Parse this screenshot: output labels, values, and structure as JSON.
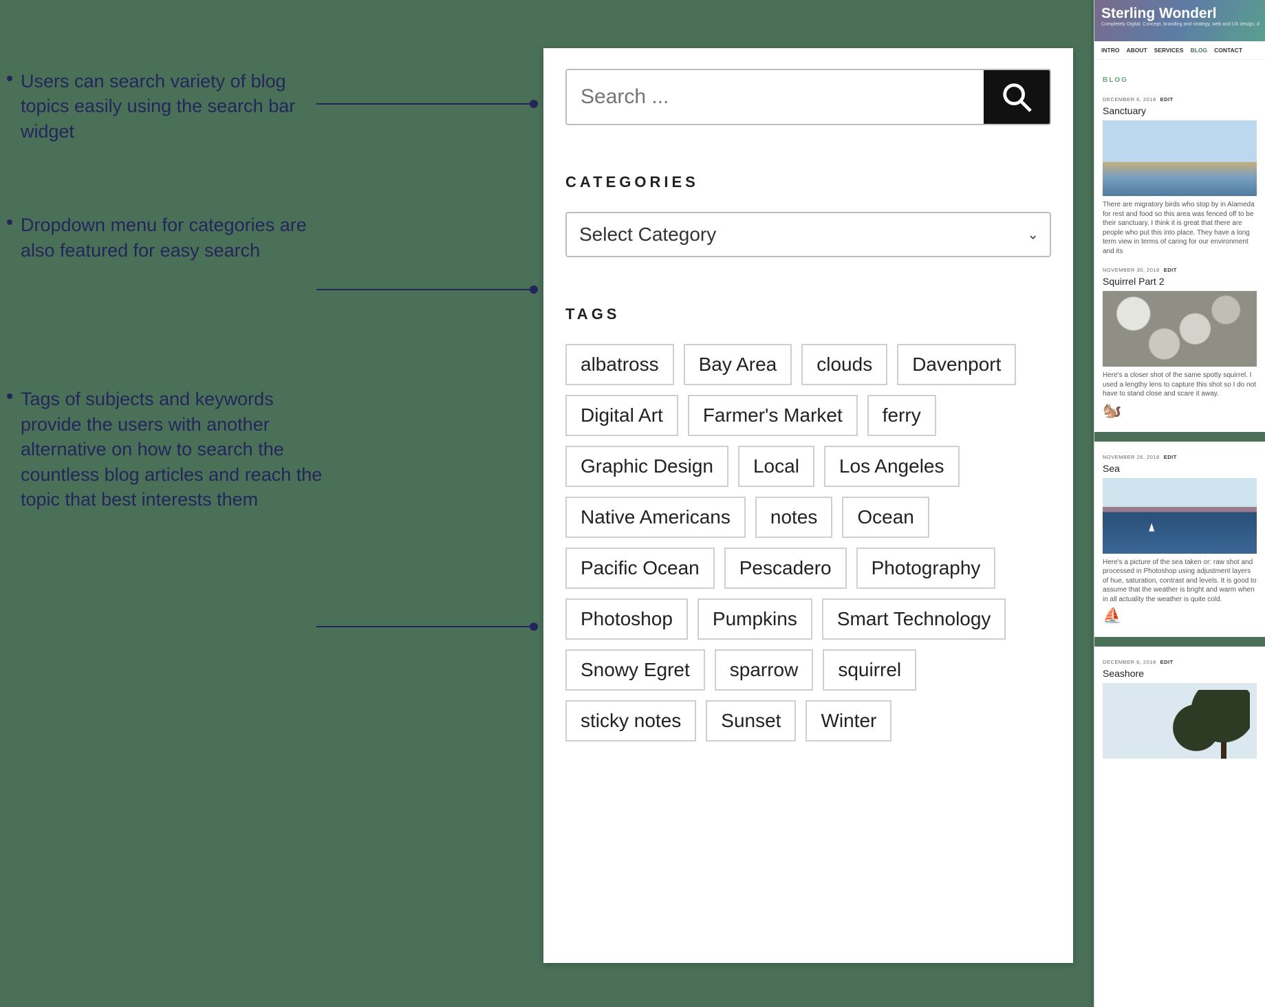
{
  "annotations": {
    "a1": "Users can search variety of blog topics easily using the search bar widget",
    "a2": "Dropdown menu for categories are also featured for easy search",
    "a3": "Tags of subjects and keywords provide the users with another alternative on how to search the countless blog articles and reach the topic that best interests them"
  },
  "sidebar": {
    "search_placeholder": "Search ...",
    "categories_heading": "CATEGORIES",
    "category_select_label": "Select Category",
    "tags_heading": "TAGS",
    "tags": [
      "albatross",
      "Bay Area",
      "clouds",
      "Davenport",
      "Digital Art",
      "Farmer's Market",
      "ferry",
      "Graphic Design",
      "Local",
      "Los Angeles",
      "Native Americans",
      "notes",
      "Ocean",
      "Pacific Ocean",
      "Pescadero",
      "Photography",
      "Photoshop",
      "Pumpkins",
      "Smart Technology",
      "Snowy Egret",
      "sparrow",
      "squirrel",
      "sticky notes",
      "Sunset",
      "Winter"
    ]
  },
  "blog_preview": {
    "site_title": "Sterling Wonderl",
    "tagline": "Completely Digital. Concept, branding and strategy, web and UX design, d",
    "nav": [
      "INTRO",
      "ABOUT",
      "SERVICES",
      "BLOG",
      "CONTACT"
    ],
    "nav_active_index": 3,
    "section_label": "BLOG",
    "posts": [
      {
        "date": "DECEMBER 6, 2018",
        "edit": "EDIT",
        "title": "Sanctuary",
        "excerpt": "There are migratory birds who stop by in Alameda for rest and food so this area was fenced off to be their sanctuary. I think it is great that there are people who put this into place. They have a long term view in terms of caring for our environment and its"
      },
      {
        "date": "NOVEMBER 30, 2018",
        "edit": "EDIT",
        "title": "Squirrel Part 2",
        "excerpt": "Here's a closer shot of the same spotty squirrel. I used a lengthy lens to capture this shot so I do not have to stand close and scare it away.",
        "emoji": "🐿️"
      },
      {
        "date": "NOVEMBER 26, 2018",
        "edit": "EDIT",
        "title": "Sea",
        "excerpt": "Here's a picture of the sea taken or: raw shot and processed in Photoshop using adjustment layers of hue, saturation, contrast and levels. It is good to assume that the weather is bright and warm when in all actuality the weather is quite cold.",
        "emoji": "⛵"
      },
      {
        "date": "DECEMBER 6, 2018",
        "edit": "EDIT",
        "title": "Seashore",
        "excerpt": ""
      }
    ]
  }
}
